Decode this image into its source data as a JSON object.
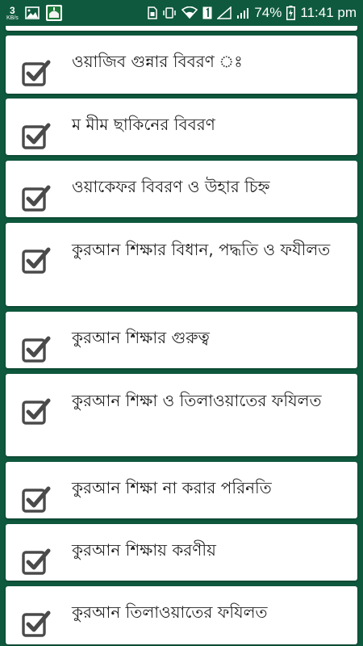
{
  "status_bar": {
    "net_speed_value": "3",
    "net_speed_unit": "KB/s",
    "left_icons": [
      "image-icon",
      "app-icon"
    ],
    "right_icons": [
      "sim-icon",
      "vibrate-icon",
      "wifi-icon",
      "sim1-icon",
      "signal-icon",
      "signal-icon",
      "battery-icon"
    ],
    "battery_percent": "74%",
    "time": "11:41 pm"
  },
  "list": {
    "items": [
      {
        "label": "ওয়াজিব গুন্নার বিবরণ ঃ"
      },
      {
        "label": "ম মীম ছাকিনের বিবরণ"
      },
      {
        "label": "ওয়াকেফর বিবরণ ও উহার চিহ্ন"
      },
      {
        "label": "কুরআন শিক্ষার বিধান, পদ্ধতি ও ফযীলত"
      },
      {
        "label": "কুরআন শিক্ষার গুরুত্ব"
      },
      {
        "label": "কুরআন শিক্ষা ও তিলাওয়াতের ফযিলত"
      },
      {
        "label": "কুরআন শিক্ষা না করার পরিনতি"
      },
      {
        "label": "কুরআন শিক্ষায় করণীয়"
      },
      {
        "label": "কুরআন তিলাওয়াতের ফযিলত"
      }
    ]
  },
  "colors": {
    "background": "#0f5a3f",
    "card": "#ffffff",
    "text": "#222222",
    "checkbox": "#4a4a4a"
  }
}
